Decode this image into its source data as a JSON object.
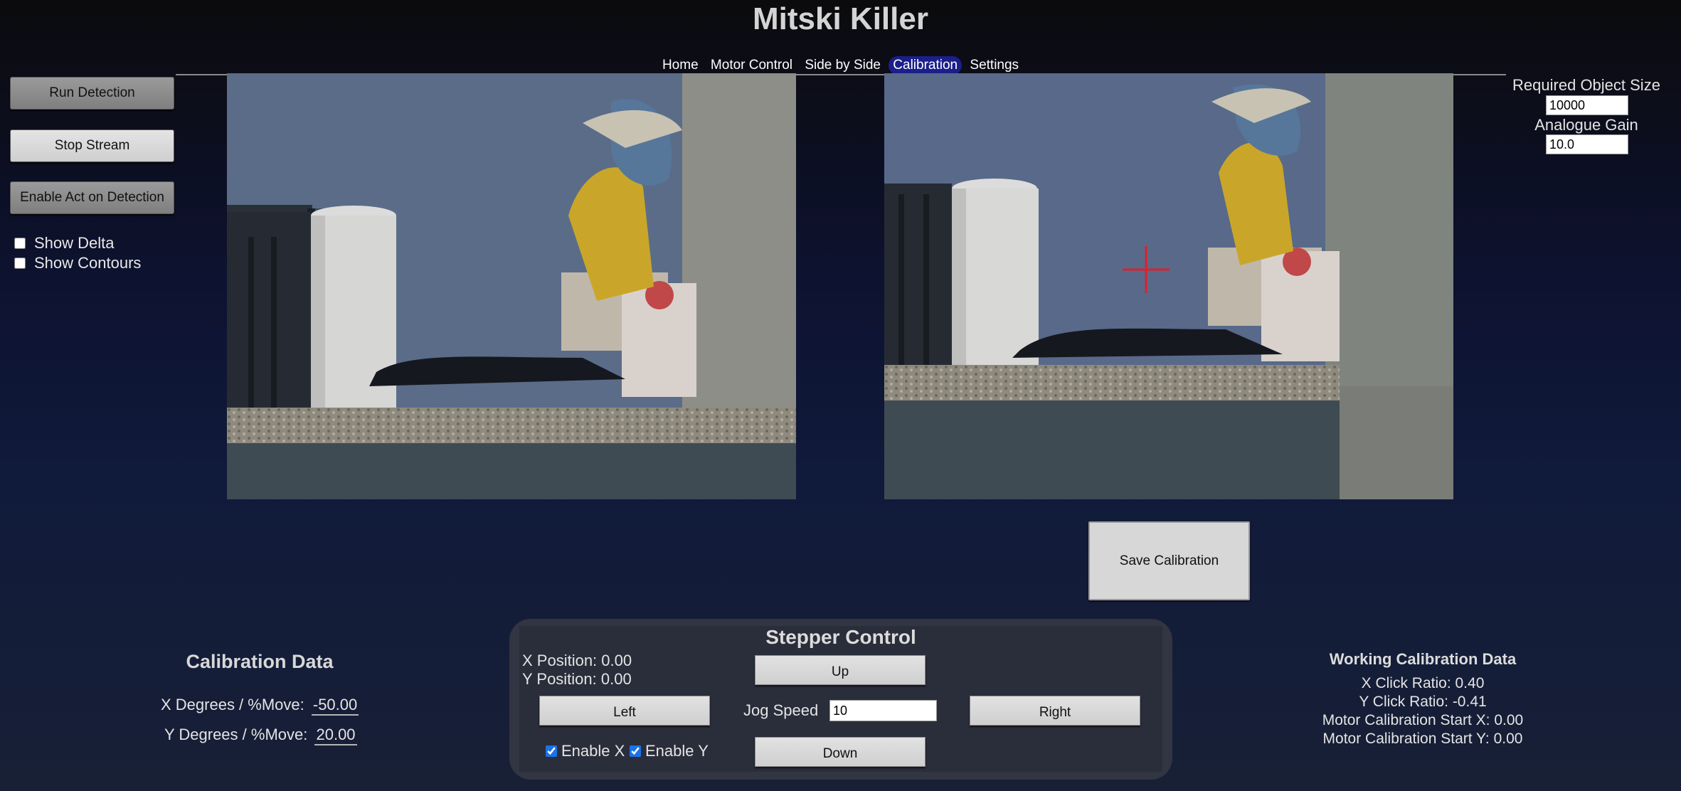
{
  "app": {
    "title": "Mitski Killer"
  },
  "nav": {
    "items": [
      {
        "label": "Home",
        "active": false
      },
      {
        "label": "Motor Control",
        "active": false
      },
      {
        "label": "Side by Side",
        "active": false
      },
      {
        "label": "Calibration",
        "active": true
      },
      {
        "label": "Settings",
        "active": false
      }
    ]
  },
  "controls": {
    "run_detection": "Run Detection",
    "stop_stream": "Stop Stream",
    "enable_act": "Enable Act on Detection",
    "show_delta": "Show Delta",
    "show_contours": "Show Contours"
  },
  "settings": {
    "object_size_label": "Required Object Size",
    "object_size_value": "10000",
    "gain_label": "Analogue Gain",
    "gain_value": "10.0"
  },
  "save": {
    "label": "Save Calibration"
  },
  "calibration": {
    "title": "Calibration Data",
    "x_label": "X Degrees / %Move:",
    "x_value": "-50.00",
    "y_label": "Y Degrees / %Move:",
    "y_value": "20.00"
  },
  "stepper": {
    "title": "Stepper Control",
    "x_pos_label": "X Position:",
    "x_pos_value": "0.00",
    "y_pos_label": "Y Position:",
    "y_pos_value": "0.00",
    "up": "Up",
    "down": "Down",
    "left": "Left",
    "right": "Right",
    "jog_label": "Jog Speed",
    "jog_value": "10",
    "enable_x": "Enable X",
    "enable_y": "Enable Y"
  },
  "working": {
    "title": "Working Calibration Data",
    "rows": [
      {
        "label": "X Click Ratio:",
        "value": "0.40"
      },
      {
        "label": "Y Click Ratio:",
        "value": "-0.41"
      },
      {
        "label": "Motor Calibration Start X:",
        "value": "0.00"
      },
      {
        "label": "Motor Calibration Start Y:",
        "value": "0.00"
      }
    ]
  },
  "colors": {
    "nav_active": "#1b1f8a",
    "crosshair": "#e0202a"
  }
}
